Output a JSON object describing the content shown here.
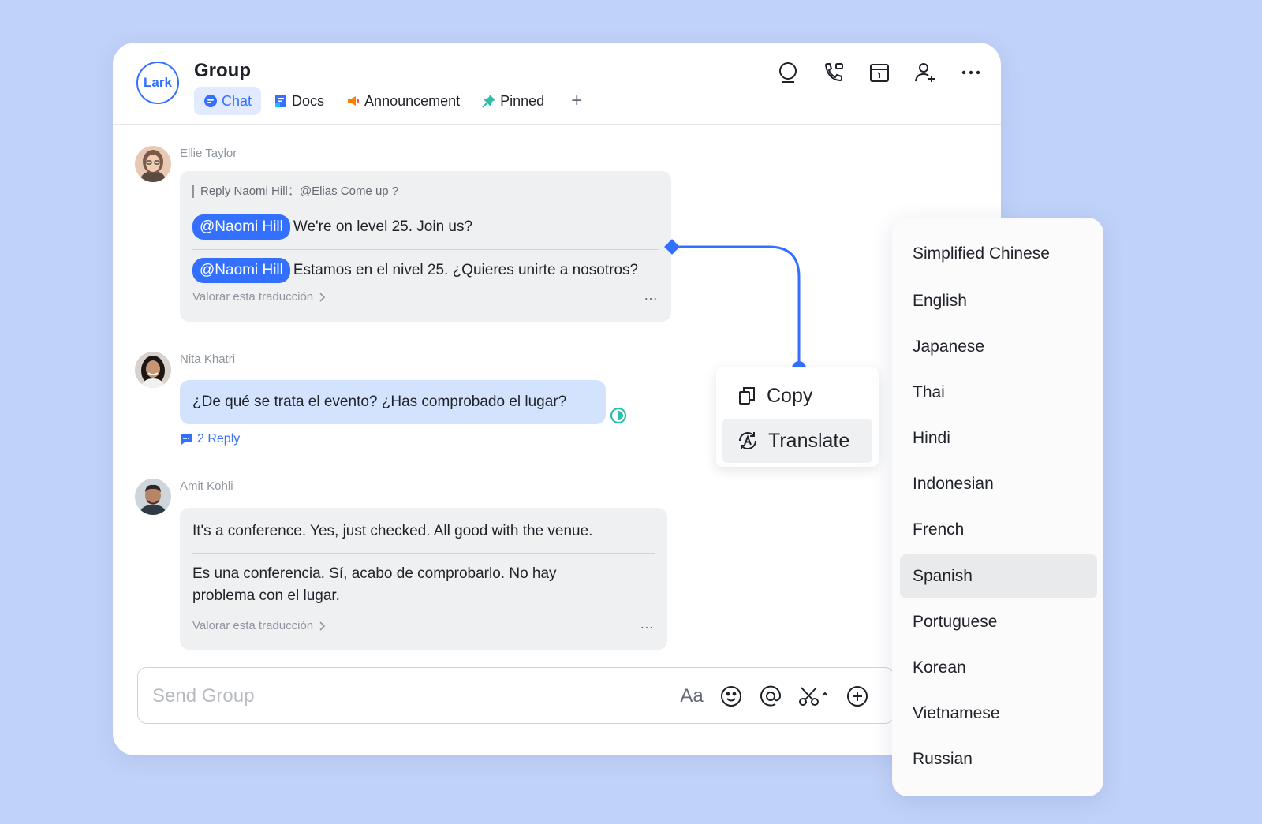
{
  "app": {
    "logo_text": "Lark",
    "title": "Group",
    "accent_color": "#3370ff"
  },
  "tabs": [
    {
      "label": "Chat",
      "icon": "chat-icon",
      "active": true
    },
    {
      "label": "Docs",
      "icon": "docs-icon",
      "active": false
    },
    {
      "label": "Announcement",
      "icon": "announcement-icon",
      "active": false
    },
    {
      "label": "Pinned",
      "icon": "pin-icon",
      "active": false
    }
  ],
  "tab_add_label": "+",
  "header_icons": [
    "search-icon",
    "call-icon",
    "calendar-icon",
    "add-member-icon",
    "more-icon"
  ],
  "messages": [
    {
      "sender": "Ellie Taylor",
      "reply_to": "Reply Naomi Hill：@Elias Come up ?",
      "mention": "@Naomi Hill",
      "text": "We're on level 25. Join us?",
      "translation_mention": "@Naomi Hill",
      "translation": "Estamos en el nivel 25. ¿Quieres unirte a nosotros?",
      "rate_label": "Valorar esta traducción",
      "more": "…"
    },
    {
      "sender": "Nita Khatri",
      "text": "¿De qué se trata el evento? ¿Has comprobado el lugar?",
      "reply_count": "2 Reply"
    },
    {
      "sender": "Amit Kohli",
      "text": "It's a conference. Yes, just checked. All good with the venue.",
      "translation": "Es una conferencia. Sí, acabo de comprobarlo. No hay problema con el lugar.",
      "rate_label": "Valorar esta traducción",
      "more": "…"
    }
  ],
  "input": {
    "placeholder": "Send Group",
    "font_label": "Aa",
    "icons": [
      "emoji-icon",
      "mention-icon",
      "scissors-icon",
      "add-circle-icon"
    ]
  },
  "context_menu": {
    "items": [
      {
        "label": "Copy",
        "icon": "copy-icon",
        "active": false
      },
      {
        "label": "Translate",
        "icon": "translate-icon",
        "active": true
      }
    ]
  },
  "languages": {
    "items": [
      "Simplified Chinese",
      "English",
      "Japanese",
      "Thai",
      "Hindi",
      "Indonesian",
      "French",
      "Spanish",
      "Portuguese",
      "Korean",
      "Vietnamese",
      "Russian"
    ],
    "selected": "Spanish"
  }
}
